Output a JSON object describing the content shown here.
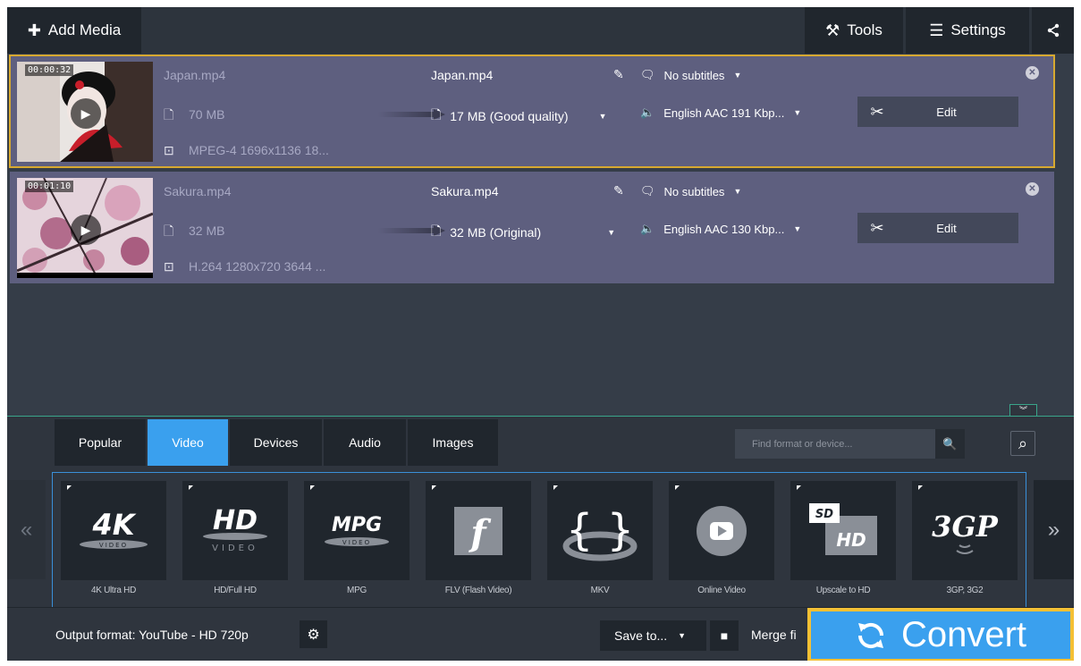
{
  "toolbar": {
    "add_media": "Add Media",
    "tools": "Tools",
    "settings": "Settings"
  },
  "files": [
    {
      "duration": "00:00:32",
      "name": "Japan.mp4",
      "size": "70 MB",
      "codec": "MPEG-4 1696x1136 18...",
      "out_name": "Japan.mp4",
      "out_size": "17 MB (Good quality)",
      "subtitles": "No subtitles",
      "audio": "English AAC 191 Kbp...",
      "edit": "Edit",
      "selected": true
    },
    {
      "duration": "00:01:10",
      "name": "Sakura.mp4",
      "size": "32 MB",
      "codec": "H.264 1280x720 3644 ...",
      "out_name": "Sakura.mp4",
      "out_size": "32 MB (Original)",
      "subtitles": "No subtitles",
      "audio": "English AAC 130 Kbp...",
      "edit": "Edit",
      "selected": false
    }
  ],
  "tabs": [
    {
      "label": "Popular",
      "active": false
    },
    {
      "label": "Video",
      "active": true
    },
    {
      "label": "Devices",
      "active": false
    },
    {
      "label": "Audio",
      "active": false
    },
    {
      "label": "Images",
      "active": false
    }
  ],
  "search": {
    "placeholder": "Find format or device..."
  },
  "formats": [
    {
      "label": "4K Ultra HD",
      "icon": "4k-icon"
    },
    {
      "label": "HD/Full HD",
      "icon": "hd-icon"
    },
    {
      "label": "MPG",
      "icon": "mpg-icon"
    },
    {
      "label": "FLV (Flash Video)",
      "icon": "flash-icon"
    },
    {
      "label": "MKV",
      "icon": "mkv-icon"
    },
    {
      "label": "Online Video",
      "icon": "online-video-icon"
    },
    {
      "label": "Upscale to HD",
      "icon": "upscale-hd-icon"
    },
    {
      "label": "3GP, 3G2",
      "icon": "3gp-icon"
    }
  ],
  "icon_text": {
    "k4": "4K",
    "video": "VIDEO",
    "hd": "HD",
    "mpg": "MPG",
    "sd": "SD",
    "g3p": "3GP"
  },
  "footer": {
    "output_format": "Output format: YouTube - HD 720p",
    "save_to": "Save to...",
    "merge": "Merge fi",
    "convert": "Convert"
  },
  "colors": {
    "accent": "#3aa0ee",
    "highlight": "#f5c034",
    "selection": "#d7a930",
    "item_bg": "#5e5f7f",
    "panel": "#353d48"
  }
}
